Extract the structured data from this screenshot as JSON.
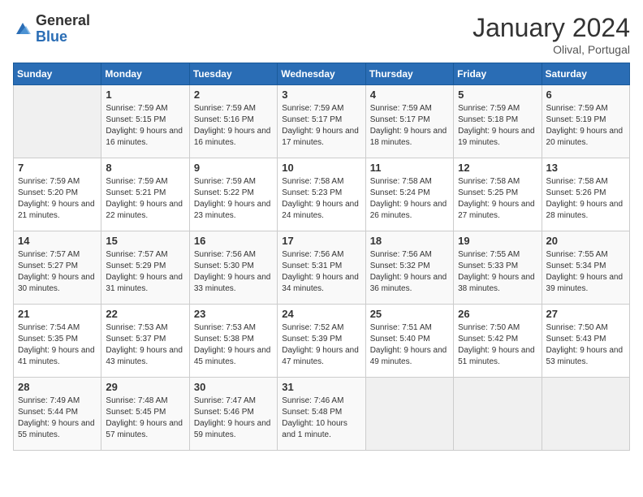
{
  "logo": {
    "general": "General",
    "blue": "Blue"
  },
  "title": "January 2024",
  "location": "Olival, Portugal",
  "days_header": [
    "Sunday",
    "Monday",
    "Tuesday",
    "Wednesday",
    "Thursday",
    "Friday",
    "Saturday"
  ],
  "weeks": [
    [
      {
        "day": "",
        "sunrise": "",
        "sunset": "",
        "daylight": ""
      },
      {
        "day": "1",
        "sunrise": "Sunrise: 7:59 AM",
        "sunset": "Sunset: 5:15 PM",
        "daylight": "Daylight: 9 hours and 16 minutes."
      },
      {
        "day": "2",
        "sunrise": "Sunrise: 7:59 AM",
        "sunset": "Sunset: 5:16 PM",
        "daylight": "Daylight: 9 hours and 16 minutes."
      },
      {
        "day": "3",
        "sunrise": "Sunrise: 7:59 AM",
        "sunset": "Sunset: 5:17 PM",
        "daylight": "Daylight: 9 hours and 17 minutes."
      },
      {
        "day": "4",
        "sunrise": "Sunrise: 7:59 AM",
        "sunset": "Sunset: 5:17 PM",
        "daylight": "Daylight: 9 hours and 18 minutes."
      },
      {
        "day": "5",
        "sunrise": "Sunrise: 7:59 AM",
        "sunset": "Sunset: 5:18 PM",
        "daylight": "Daylight: 9 hours and 19 minutes."
      },
      {
        "day": "6",
        "sunrise": "Sunrise: 7:59 AM",
        "sunset": "Sunset: 5:19 PM",
        "daylight": "Daylight: 9 hours and 20 minutes."
      }
    ],
    [
      {
        "day": "7",
        "sunrise": "Sunrise: 7:59 AM",
        "sunset": "Sunset: 5:20 PM",
        "daylight": "Daylight: 9 hours and 21 minutes."
      },
      {
        "day": "8",
        "sunrise": "Sunrise: 7:59 AM",
        "sunset": "Sunset: 5:21 PM",
        "daylight": "Daylight: 9 hours and 22 minutes."
      },
      {
        "day": "9",
        "sunrise": "Sunrise: 7:59 AM",
        "sunset": "Sunset: 5:22 PM",
        "daylight": "Daylight: 9 hours and 23 minutes."
      },
      {
        "day": "10",
        "sunrise": "Sunrise: 7:58 AM",
        "sunset": "Sunset: 5:23 PM",
        "daylight": "Daylight: 9 hours and 24 minutes."
      },
      {
        "day": "11",
        "sunrise": "Sunrise: 7:58 AM",
        "sunset": "Sunset: 5:24 PM",
        "daylight": "Daylight: 9 hours and 26 minutes."
      },
      {
        "day": "12",
        "sunrise": "Sunrise: 7:58 AM",
        "sunset": "Sunset: 5:25 PM",
        "daylight": "Daylight: 9 hours and 27 minutes."
      },
      {
        "day": "13",
        "sunrise": "Sunrise: 7:58 AM",
        "sunset": "Sunset: 5:26 PM",
        "daylight": "Daylight: 9 hours and 28 minutes."
      }
    ],
    [
      {
        "day": "14",
        "sunrise": "Sunrise: 7:57 AM",
        "sunset": "Sunset: 5:27 PM",
        "daylight": "Daylight: 9 hours and 30 minutes."
      },
      {
        "day": "15",
        "sunrise": "Sunrise: 7:57 AM",
        "sunset": "Sunset: 5:29 PM",
        "daylight": "Daylight: 9 hours and 31 minutes."
      },
      {
        "day": "16",
        "sunrise": "Sunrise: 7:56 AM",
        "sunset": "Sunset: 5:30 PM",
        "daylight": "Daylight: 9 hours and 33 minutes."
      },
      {
        "day": "17",
        "sunrise": "Sunrise: 7:56 AM",
        "sunset": "Sunset: 5:31 PM",
        "daylight": "Daylight: 9 hours and 34 minutes."
      },
      {
        "day": "18",
        "sunrise": "Sunrise: 7:56 AM",
        "sunset": "Sunset: 5:32 PM",
        "daylight": "Daylight: 9 hours and 36 minutes."
      },
      {
        "day": "19",
        "sunrise": "Sunrise: 7:55 AM",
        "sunset": "Sunset: 5:33 PM",
        "daylight": "Daylight: 9 hours and 38 minutes."
      },
      {
        "day": "20",
        "sunrise": "Sunrise: 7:55 AM",
        "sunset": "Sunset: 5:34 PM",
        "daylight": "Daylight: 9 hours and 39 minutes."
      }
    ],
    [
      {
        "day": "21",
        "sunrise": "Sunrise: 7:54 AM",
        "sunset": "Sunset: 5:35 PM",
        "daylight": "Daylight: 9 hours and 41 minutes."
      },
      {
        "day": "22",
        "sunrise": "Sunrise: 7:53 AM",
        "sunset": "Sunset: 5:37 PM",
        "daylight": "Daylight: 9 hours and 43 minutes."
      },
      {
        "day": "23",
        "sunrise": "Sunrise: 7:53 AM",
        "sunset": "Sunset: 5:38 PM",
        "daylight": "Daylight: 9 hours and 45 minutes."
      },
      {
        "day": "24",
        "sunrise": "Sunrise: 7:52 AM",
        "sunset": "Sunset: 5:39 PM",
        "daylight": "Daylight: 9 hours and 47 minutes."
      },
      {
        "day": "25",
        "sunrise": "Sunrise: 7:51 AM",
        "sunset": "Sunset: 5:40 PM",
        "daylight": "Daylight: 9 hours and 49 minutes."
      },
      {
        "day": "26",
        "sunrise": "Sunrise: 7:50 AM",
        "sunset": "Sunset: 5:42 PM",
        "daylight": "Daylight: 9 hours and 51 minutes."
      },
      {
        "day": "27",
        "sunrise": "Sunrise: 7:50 AM",
        "sunset": "Sunset: 5:43 PM",
        "daylight": "Daylight: 9 hours and 53 minutes."
      }
    ],
    [
      {
        "day": "28",
        "sunrise": "Sunrise: 7:49 AM",
        "sunset": "Sunset: 5:44 PM",
        "daylight": "Daylight: 9 hours and 55 minutes."
      },
      {
        "day": "29",
        "sunrise": "Sunrise: 7:48 AM",
        "sunset": "Sunset: 5:45 PM",
        "daylight": "Daylight: 9 hours and 57 minutes."
      },
      {
        "day": "30",
        "sunrise": "Sunrise: 7:47 AM",
        "sunset": "Sunset: 5:46 PM",
        "daylight": "Daylight: 9 hours and 59 minutes."
      },
      {
        "day": "31",
        "sunrise": "Sunrise: 7:46 AM",
        "sunset": "Sunset: 5:48 PM",
        "daylight": "Daylight: 10 hours and 1 minute."
      },
      {
        "day": "",
        "sunrise": "",
        "sunset": "",
        "daylight": ""
      },
      {
        "day": "",
        "sunrise": "",
        "sunset": "",
        "daylight": ""
      },
      {
        "day": "",
        "sunrise": "",
        "sunset": "",
        "daylight": ""
      }
    ]
  ]
}
